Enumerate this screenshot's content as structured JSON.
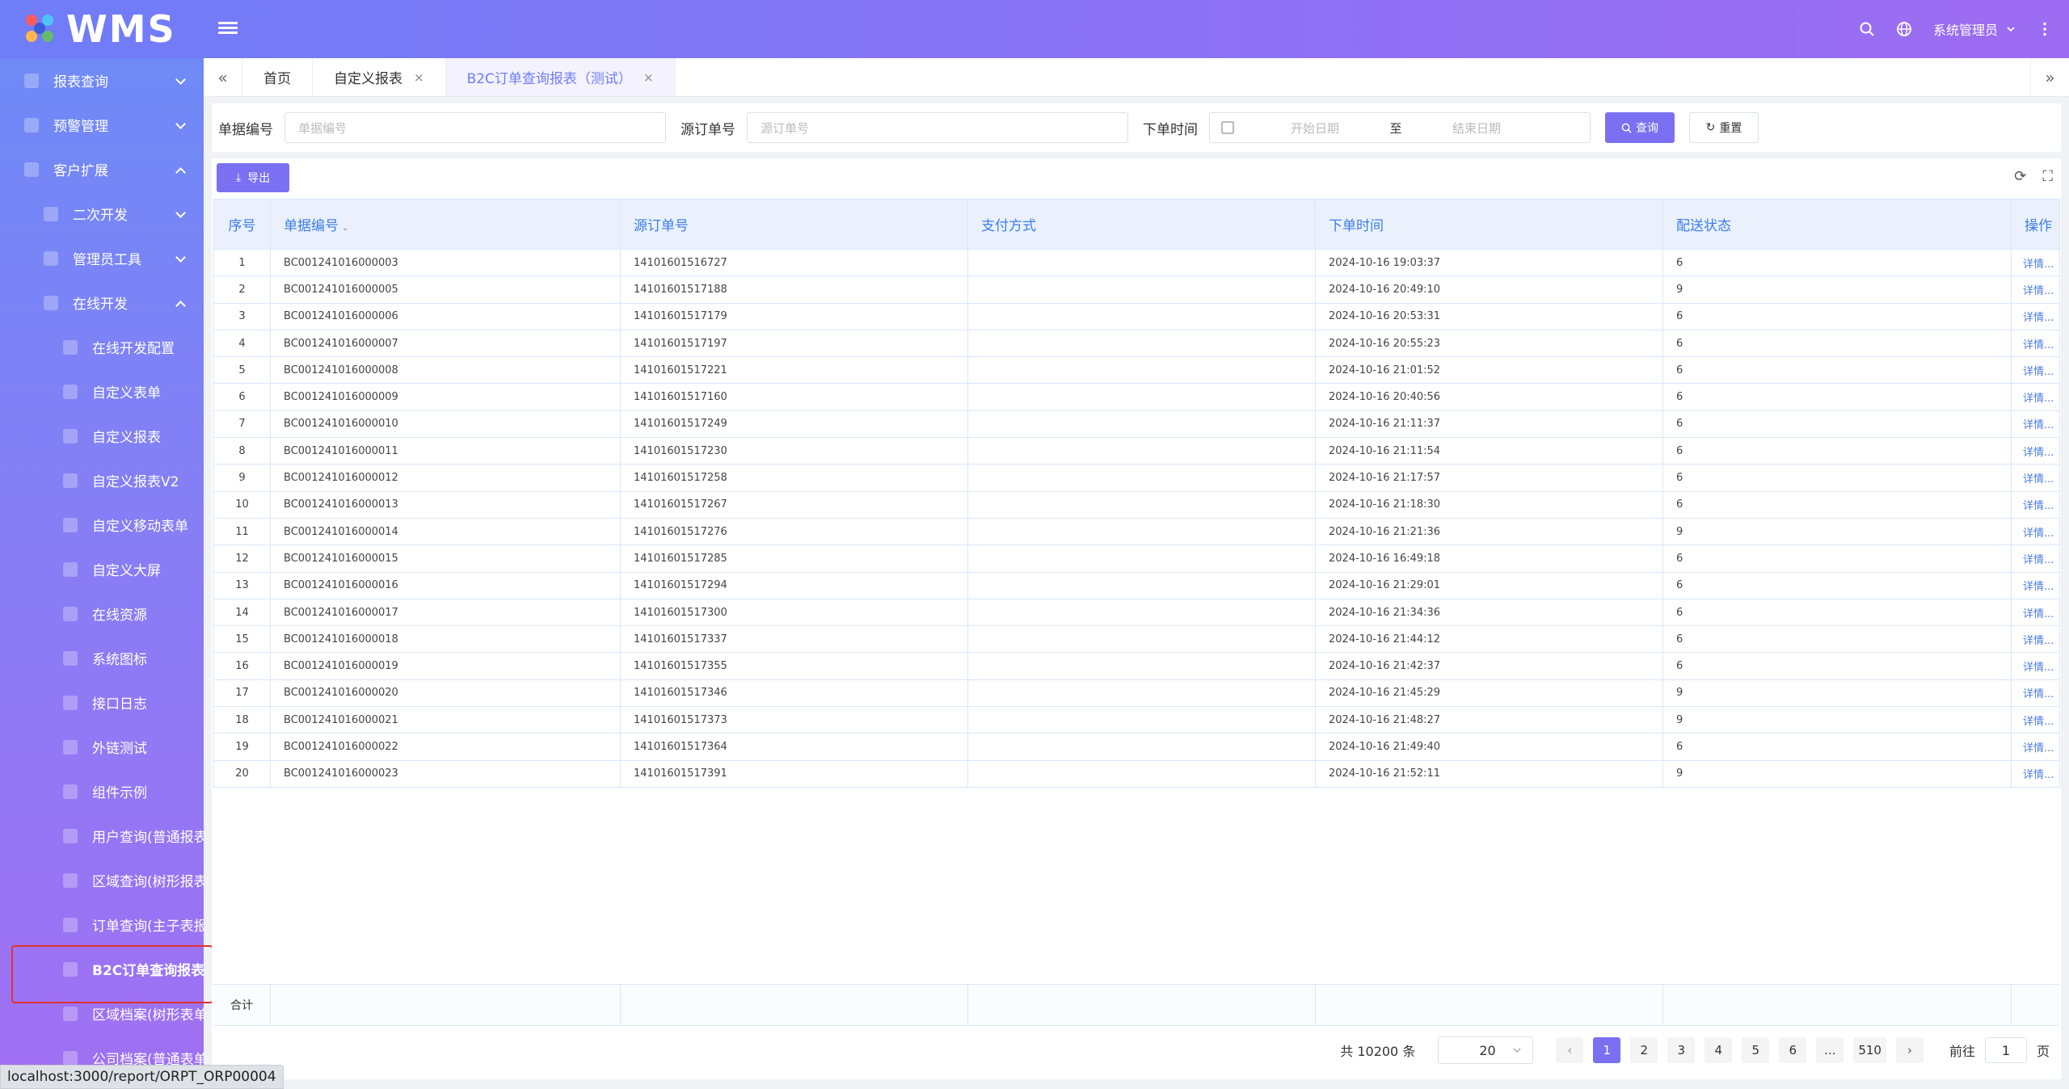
{
  "app": {
    "title": "WMS"
  },
  "header": {
    "user": "系统管理员"
  },
  "sidebar": {
    "items": [
      {
        "label": "报表查询",
        "level": 1,
        "arrow": "down"
      },
      {
        "label": "预警管理",
        "level": 1,
        "arrow": "down"
      },
      {
        "label": "客户扩展",
        "level": 1,
        "arrow": "up"
      },
      {
        "label": "二次开发",
        "level": 2,
        "arrow": "down"
      },
      {
        "label": "管理员工具",
        "level": 2,
        "arrow": "down"
      },
      {
        "label": "在线开发",
        "level": 2,
        "arrow": "up"
      },
      {
        "label": "在线开发配置",
        "level": 3
      },
      {
        "label": "自定义表单",
        "level": 3
      },
      {
        "label": "自定义报表",
        "level": 3
      },
      {
        "label": "自定义报表V2",
        "level": 3
      },
      {
        "label": "自定义移动表单",
        "level": 3
      },
      {
        "label": "自定义大屏",
        "level": 3
      },
      {
        "label": "在线资源",
        "level": 3
      },
      {
        "label": "系统图标",
        "level": 3
      },
      {
        "label": "接口日志",
        "level": 3
      },
      {
        "label": "外链测试",
        "level": 3
      },
      {
        "label": "组件示例",
        "level": 3
      },
      {
        "label": "用户查询(普通报表",
        "level": 3
      },
      {
        "label": "区域查询(树形报表",
        "level": 3
      },
      {
        "label": "订单查询(主子表报",
        "level": 3
      },
      {
        "label": "B2C订单查询报表",
        "level": 3,
        "active": true
      },
      {
        "label": "区域档案(树形表单",
        "level": 3
      },
      {
        "label": "公司档案(普通表单",
        "level": 3
      }
    ]
  },
  "tabs": [
    {
      "label": "首页",
      "closable": false
    },
    {
      "label": "自定义报表",
      "closable": true
    },
    {
      "label": "B2C订单查询报表（测试）",
      "closable": true,
      "active": true
    }
  ],
  "search": {
    "doc_no_label": "单据编号",
    "doc_no_placeholder": "单据编号",
    "src_no_label": "源订单号",
    "src_no_placeholder": "源订单号",
    "order_time_label": "下单时间",
    "start_placeholder": "开始日期",
    "range_sep": "至",
    "end_placeholder": "结束日期",
    "query_label": "查询",
    "reset_label": "重置"
  },
  "toolbar": {
    "export_label": "导出"
  },
  "table": {
    "columns": [
      "序号",
      "单据编号",
      "源订单号",
      "支付方式",
      "下单时间",
      "配送状态",
      "操作"
    ],
    "op_label": "详情...",
    "rows": [
      [
        "1",
        "BC001241016000003",
        "14101601516727",
        "",
        "2024-10-16 19:03:37",
        "6"
      ],
      [
        "2",
        "BC001241016000005",
        "14101601517188",
        "",
        "2024-10-16 20:49:10",
        "9"
      ],
      [
        "3",
        "BC001241016000006",
        "14101601517179",
        "",
        "2024-10-16 20:53:31",
        "6"
      ],
      [
        "4",
        "BC001241016000007",
        "14101601517197",
        "",
        "2024-10-16 20:55:23",
        "6"
      ],
      [
        "5",
        "BC001241016000008",
        "14101601517221",
        "",
        "2024-10-16 21:01:52",
        "6"
      ],
      [
        "6",
        "BC001241016000009",
        "14101601517160",
        "",
        "2024-10-16 20:40:56",
        "6"
      ],
      [
        "7",
        "BC001241016000010",
        "14101601517249",
        "",
        "2024-10-16 21:11:37",
        "6"
      ],
      [
        "8",
        "BC001241016000011",
        "14101601517230",
        "",
        "2024-10-16 21:11:54",
        "6"
      ],
      [
        "9",
        "BC001241016000012",
        "14101601517258",
        "",
        "2024-10-16 21:17:57",
        "6"
      ],
      [
        "10",
        "BC001241016000013",
        "14101601517267",
        "",
        "2024-10-16 21:18:30",
        "6"
      ],
      [
        "11",
        "BC001241016000014",
        "14101601517276",
        "",
        "2024-10-16 21:21:36",
        "9"
      ],
      [
        "12",
        "BC001241016000015",
        "14101601517285",
        "",
        "2024-10-16 16:49:18",
        "6"
      ],
      [
        "13",
        "BC001241016000016",
        "14101601517294",
        "",
        "2024-10-16 21:29:01",
        "6"
      ],
      [
        "14",
        "BC001241016000017",
        "14101601517300",
        "",
        "2024-10-16 21:34:36",
        "6"
      ],
      [
        "15",
        "BC001241016000018",
        "14101601517337",
        "",
        "2024-10-16 21:44:12",
        "6"
      ],
      [
        "16",
        "BC001241016000019",
        "14101601517355",
        "",
        "2024-10-16 21:42:37",
        "6"
      ],
      [
        "17",
        "BC001241016000020",
        "14101601517346",
        "",
        "2024-10-16 21:45:29",
        "9"
      ],
      [
        "18",
        "BC001241016000021",
        "14101601517373",
        "",
        "2024-10-16 21:48:27",
        "9"
      ],
      [
        "19",
        "BC001241016000022",
        "14101601517364",
        "",
        "2024-10-16 21:49:40",
        "6"
      ],
      [
        "20",
        "BC001241016000023",
        "14101601517391",
        "",
        "2024-10-16 21:52:11",
        "9"
      ]
    ],
    "summary_label": "合计"
  },
  "pagination": {
    "total_text": "共 10200 条",
    "page_size": "20",
    "pages": [
      "1",
      "2",
      "3",
      "4",
      "5",
      "6",
      "...",
      "510"
    ],
    "current": "1",
    "goto_label": "前往",
    "goto_value": "1",
    "goto_suffix": "页"
  },
  "statusbar": {
    "url": "localhost:3000/report/ORPT_ORP00004"
  },
  "colors": {
    "accent": "#7b6ff2",
    "header_from": "#6f7df8",
    "header_to": "#9d6cf2",
    "link": "#4b7be6",
    "highlight": "#e03131"
  }
}
